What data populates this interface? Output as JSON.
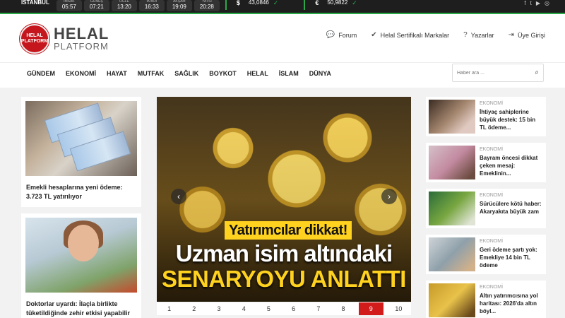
{
  "topbar": {
    "city": "İSTANBUL",
    "prayer_times": [
      {
        "label": "İMSAK",
        "time": "05:57"
      },
      {
        "label": "GÜNEŞ",
        "time": "07:21"
      },
      {
        "label": "ÖĞLE",
        "time": "13:20"
      },
      {
        "label": "İKİNDİ",
        "time": "16:33"
      },
      {
        "label": "AKŞAM",
        "time": "19:09"
      },
      {
        "label": "YATSI",
        "time": "20:28"
      }
    ],
    "currencies": [
      {
        "symbol": "$",
        "value": "43,0846"
      },
      {
        "symbol": "€",
        "value": "50,9822"
      }
    ],
    "accent": "#2aa84a"
  },
  "header": {
    "logo_badge": "HELAL PLATFORM",
    "logo_title": "HELAL",
    "logo_sub": "PLATFORM",
    "links": [
      {
        "icon": "chat-icon",
        "label": "Forum"
      },
      {
        "icon": "certificate-icon",
        "label": "Helal Sertifikalı Markalar"
      },
      {
        "icon": "question-icon",
        "label": "Yazarlar"
      },
      {
        "icon": "login-icon",
        "label": "Üye Girişi"
      }
    ]
  },
  "nav": {
    "items": [
      "GÜNDEM",
      "EKONOMİ",
      "HAYAT",
      "MUTFAK",
      "SAĞLIK",
      "BOYKOT",
      "HELAL",
      "İSLAM",
      "DÜNYA"
    ],
    "search_placeholder": "Haber ara ..."
  },
  "left": [
    {
      "caption": "Emekli hesaplarına yeni ödeme: 3.723 TL yatırılıyor"
    },
    {
      "caption": "Doktorlar uyardı: İlaçla birlikte tüketildiğinde zehir etkisi yapabilir"
    }
  ],
  "slider": {
    "tag": "Yatırımcılar dikkat!",
    "line1": "Uzman isim altındaki",
    "line2": "SENARYOYU ANLATTI",
    "pages": [
      "1",
      "2",
      "3",
      "4",
      "5",
      "6",
      "7",
      "8",
      "9",
      "10"
    ],
    "active_page": "9",
    "active_color": "#d21c1c"
  },
  "right": [
    {
      "category": "EKONOMİ",
      "title": "İhtiyaç sahiplerine büyük destek: 15 bin TL ödeme..."
    },
    {
      "category": "EKONOMİ",
      "title": "Bayram öncesi dikkat çeken mesaj: Emeklinin..."
    },
    {
      "category": "EKONOMİ",
      "title": "Sürücülere kötü haber: Akaryakıta büyük zam"
    },
    {
      "category": "EKONOMİ",
      "title": "Geri ödeme şartı yok: Emekliye 14 bin TL ödeme"
    },
    {
      "category": "EKONOMİ",
      "title": "Altın yatırımcısına yol haritası: 2026'da altın böyl..."
    }
  ]
}
